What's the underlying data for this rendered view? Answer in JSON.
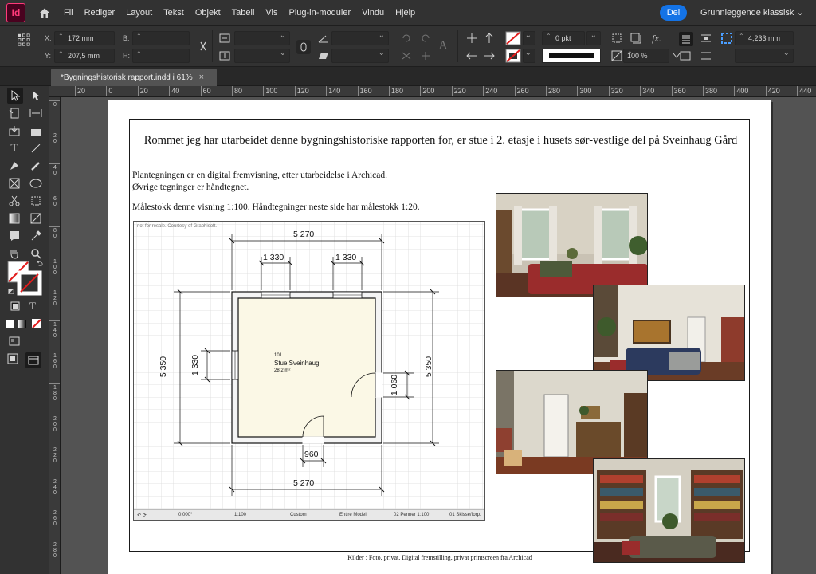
{
  "app": {
    "logo_text": "Id"
  },
  "menu": [
    "Fil",
    "Rediger",
    "Layout",
    "Tekst",
    "Objekt",
    "Tabell",
    "Vis",
    "Plug-in-moduler",
    "Vindu",
    "Hjelp"
  ],
  "share_label": "Del",
  "workspace_label": "Grunnleggende klassisk ⌄",
  "control": {
    "x_label": "X:",
    "x_value": "172 mm",
    "y_label": "Y:",
    "y_value": "207,5 mm",
    "w_label": "B:",
    "h_label": "H:",
    "stroke_value": "0 pkt",
    "zoom_value": "100 %",
    "gap_value": "4,233 mm"
  },
  "document_tab": {
    "title": "*Bygningshistorisk rapport.indd i 61%",
    "close": "×"
  },
  "ruler_top": [
    "20",
    "0",
    "20",
    "40",
    "60",
    "80",
    "100",
    "120",
    "140",
    "160",
    "180",
    "200",
    "220",
    "240",
    "260",
    "280",
    "300",
    "320",
    "340",
    "360",
    "380",
    "400",
    "420",
    "440"
  ],
  "ruler_left": [
    "0",
    "20",
    "40",
    "60",
    "80",
    "100",
    "120",
    "140",
    "160",
    "180",
    "200",
    "220",
    "240",
    "260",
    "280"
  ],
  "page": {
    "title": "Rommet jeg har utarbeidet denne bygningshistoriske rapporten for, er stue i 2. etasje i husets sør-vestlige del på Sveinhaug Gård",
    "line1": "Plantegningen er en digital fremvisning, etter utarbeidelse i Archicad.",
    "line2": "Øvrige tegninger er håndtegnet.",
    "line3": "Målestokk denne visning 1:100.  Håndtegninger neste side har målestokk 1:20.",
    "caption": "Kilder : Foto, privat. Digital fremstilling, privat printscreen fra Archicad"
  },
  "plan": {
    "watermark": "not for resale. Courtesy of Graphisoft.",
    "room_number": "101",
    "room_name": "Stue Sveinhaug",
    "room_area": "28,2 m²",
    "dim_top": "5 270",
    "dim_window_left": "1 330",
    "dim_window_right": "1 330",
    "dim_left": "5 350",
    "dim_left_window": "1 330",
    "dim_right": "5 350",
    "dim_right_door": "1 060",
    "dim_door_bottom": "960",
    "dim_bottom": "5 270",
    "status": {
      "angle": "0,000°",
      "scale": "1:100",
      "custom": "Custom",
      "model": "Entire Model",
      "pens": "02 Penner 1:100",
      "layer": "01 Skisse/forp."
    }
  },
  "colors": {
    "accent": "#1473e6",
    "room_fill": "#fbf8e6",
    "indesign": "#ff3a7a"
  }
}
